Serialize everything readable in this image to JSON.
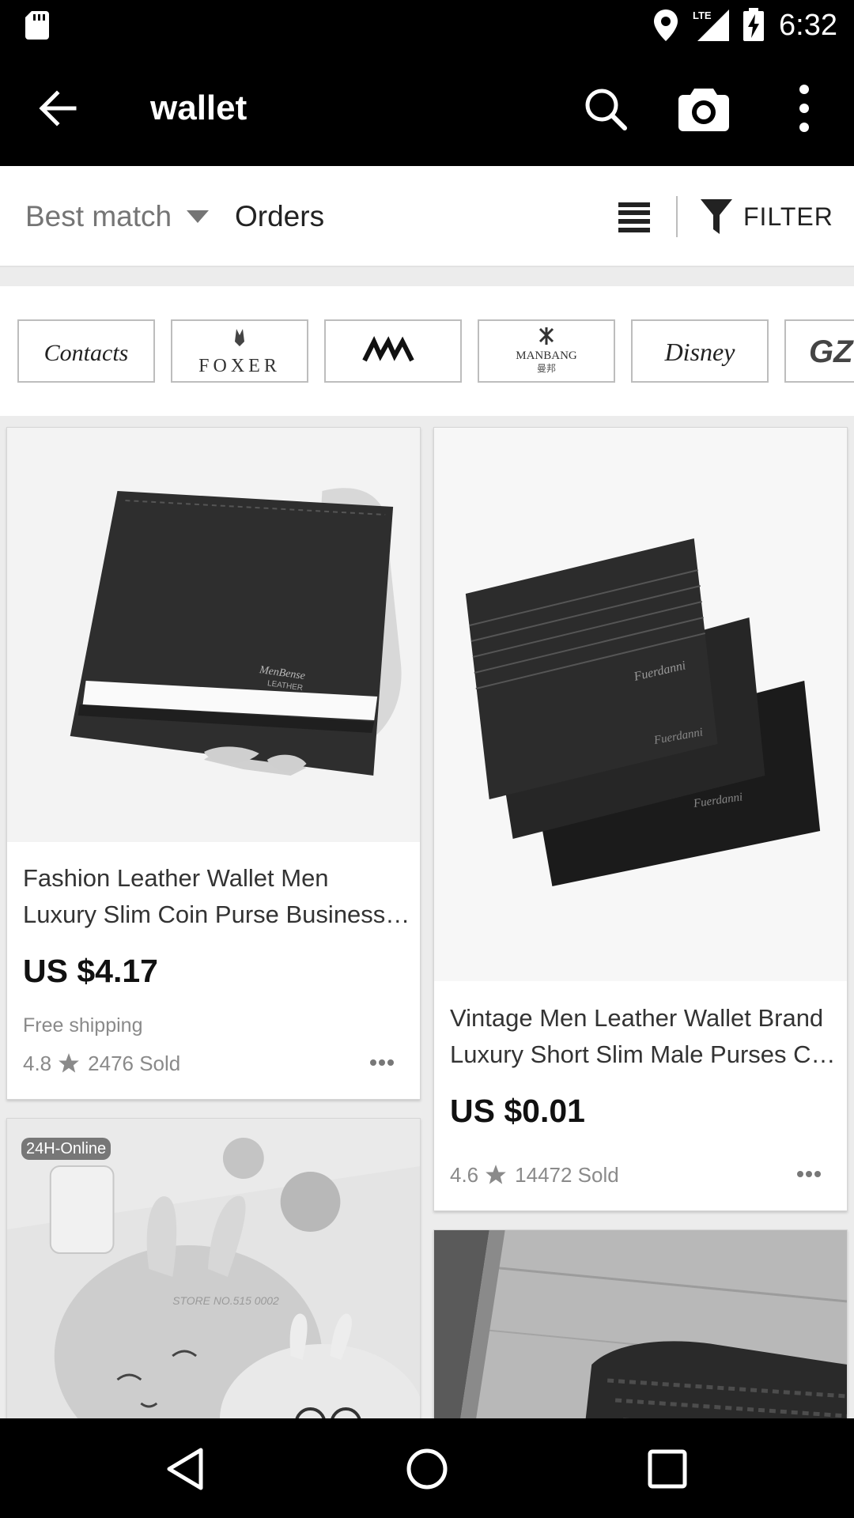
{
  "status_bar": {
    "time": "6:32",
    "network": "LTE"
  },
  "app_bar": {
    "query": "wallet"
  },
  "sort_bar": {
    "best_match": "Best match",
    "orders": "Orders",
    "filter": "FILTER"
  },
  "brands": [
    "Contacts",
    "FOXER",
    "MVA",
    "MANBANG",
    "Disney",
    "GZ"
  ],
  "products": [
    {
      "title_line1": "Fashion Leather Wallet Men",
      "title_line2": "Luxury Slim Coin Purse Business Card Holder",
      "price": "US $4.17",
      "shipping": "Free shipping",
      "rating": "4.8",
      "sold": "2476 Sold"
    },
    {
      "title_line1": "Vintage Men Leather Wallet Brand",
      "title_line2": "Luxury Short Slim Male Purses Card Holder",
      "price": "US $0.01",
      "rating": "4.6",
      "sold": "14472 Sold"
    },
    {
      "badge": "24H-Online"
    },
    {}
  ],
  "icons": {
    "status": [
      "sd-card-icon",
      "location-icon",
      "signal-icon",
      "battery-icon"
    ],
    "app_bar": [
      "back-arrow-icon",
      "search-icon",
      "camera-icon",
      "more-vert-icon"
    ],
    "sort_bar": [
      "caret-down-icon",
      "list-view-icon",
      "filter-icon"
    ],
    "nav": [
      "nav-back-icon",
      "nav-home-icon",
      "nav-recents-icon"
    ]
  }
}
